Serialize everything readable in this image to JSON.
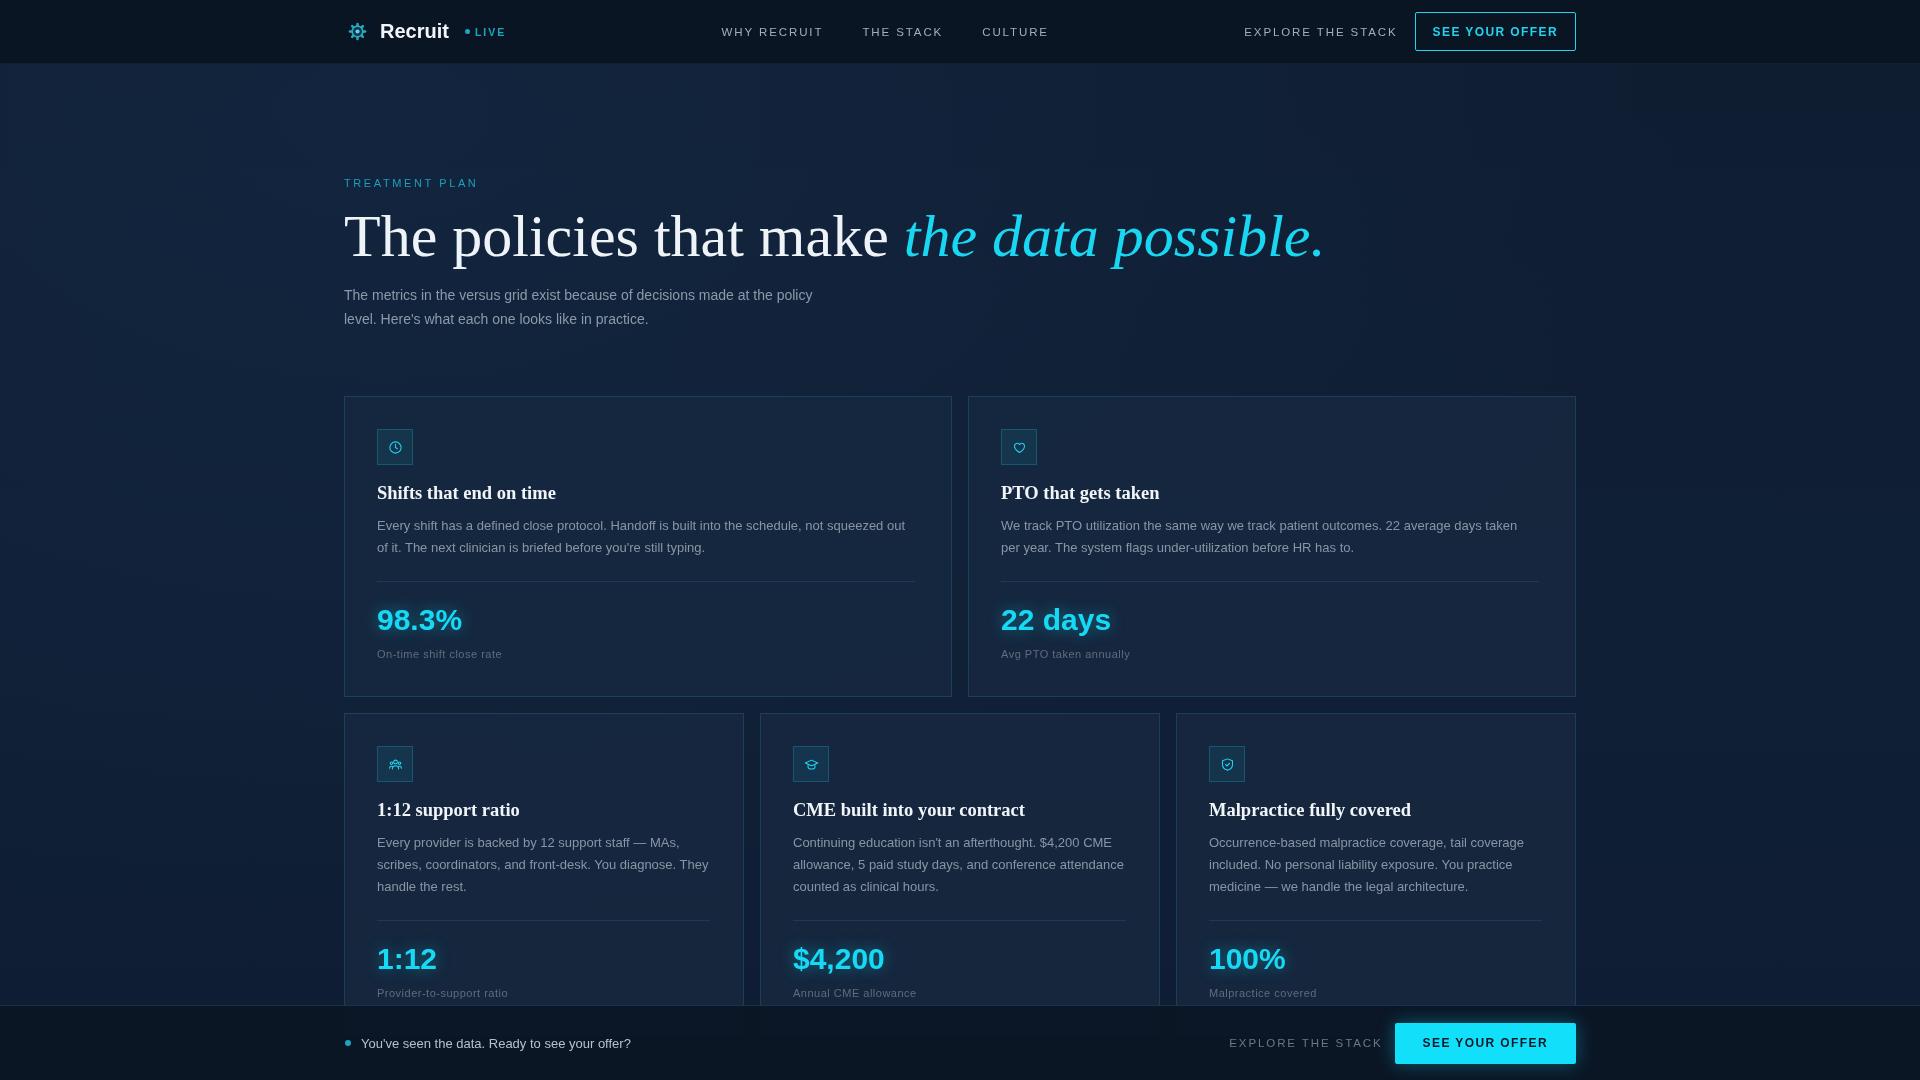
{
  "nav": {
    "brand": "Recruit",
    "badge": "LIVE",
    "links": [
      "WHY RECRUIT",
      "THE STACK",
      "CULTURE"
    ],
    "secondary_link": "EXPLORE THE STACK",
    "button": "SEE YOUR OFFER"
  },
  "hero": {
    "eyebrow": "TREATMENT PLAN",
    "title": "The policies that make *the data possible.*",
    "description": "The metrics in the versus grid exist because of decisions made at the policy level. Here's what each one looks like in practice."
  },
  "card_rows": [
    {
      "cards": [
        {
          "title": "Shifts that end on time",
          "description": "Every shift has a defined close protocol. Handoff is built into the schedule, not squeezed out of it. The next clinician is briefed before you're still typing.",
          "metric": "98.3%",
          "metric_label": "On-time shift close rate"
        },
        {
          "title": "PTO that gets taken",
          "description": "We track PTO utilization the same way we track patient outcomes. 22 average days taken per year. The system flags under-utilization before HR has to.",
          "metric": "22 days",
          "metric_label": "Avg PTO taken annually"
        }
      ]
    },
    {
      "cards": [
        {
          "title": "1:12 support ratio",
          "description": "Every provider is backed by 12 support staff — MAs, scribes, coordinators, and front-desk. You diagnose. They handle the rest.",
          "metric": "1:12",
          "metric_label": "Provider-to-support ratio"
        },
        {
          "title": "CME built into your contract",
          "description": "Continuing education isn't an afterthought. $4,200 CME allowance, 5 paid study days, and conference attendance counted as clinical hours.",
          "metric": "$4,200",
          "metric_label": "Annual CME allowance"
        },
        {
          "title": "Malpractice fully covered",
          "description": "Occurrence-based malpractice coverage, tail coverage included. No personal liability exposure. You practice medicine — we handle the legal architecture.",
          "metric": "100%",
          "metric_label": "Malpractice covered"
        }
      ]
    }
  ],
  "bottom_bar": {
    "message": "You've seen the data. Ready to see your offer?",
    "link": "EXPLORE THE STACK",
    "button": "SEE YOUR OFFER"
  }
}
